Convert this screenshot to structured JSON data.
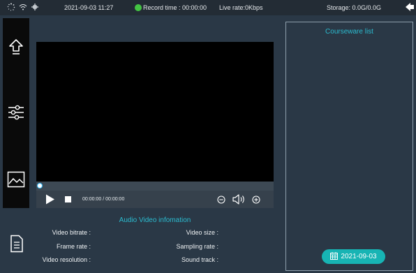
{
  "status_bar": {
    "datetime": "2021-09-03 11:27",
    "record_time": "Record time : 00:00:00",
    "live_rate": "Live rate:0Kbps",
    "storage": "Storage: 0.0G/0.0G",
    "icons": [
      "loading-icon",
      "wifi-icon",
      "network-icon",
      "record-status-icon",
      "back-icon"
    ],
    "record_status_color": "#43c443"
  },
  "sidebar": {
    "items": [
      "upload-icon",
      "settings-icon",
      "image-icon"
    ],
    "bottom_item": "document-icon"
  },
  "player": {
    "progress": 0.0,
    "time": "00:00:00 / 00:00:00",
    "controls": [
      "play-icon",
      "stop-icon",
      "zoom-out-icon",
      "volume-icon",
      "zoom-in-icon"
    ]
  },
  "av_info": {
    "title": "Audio Video infomation",
    "video_bitrate": "Video bitrate :",
    "video_size": "Video size :",
    "frame_rate": "Frame rate :",
    "sampling_rate": "Sampling rate :",
    "video_resolution": "Video resolution :",
    "sound_track": "Sound track :"
  },
  "courseware": {
    "title": "Courseware list",
    "date": "2021-09-03",
    "accent": "#2bbcd0",
    "pill_color": "#17b4b4"
  }
}
